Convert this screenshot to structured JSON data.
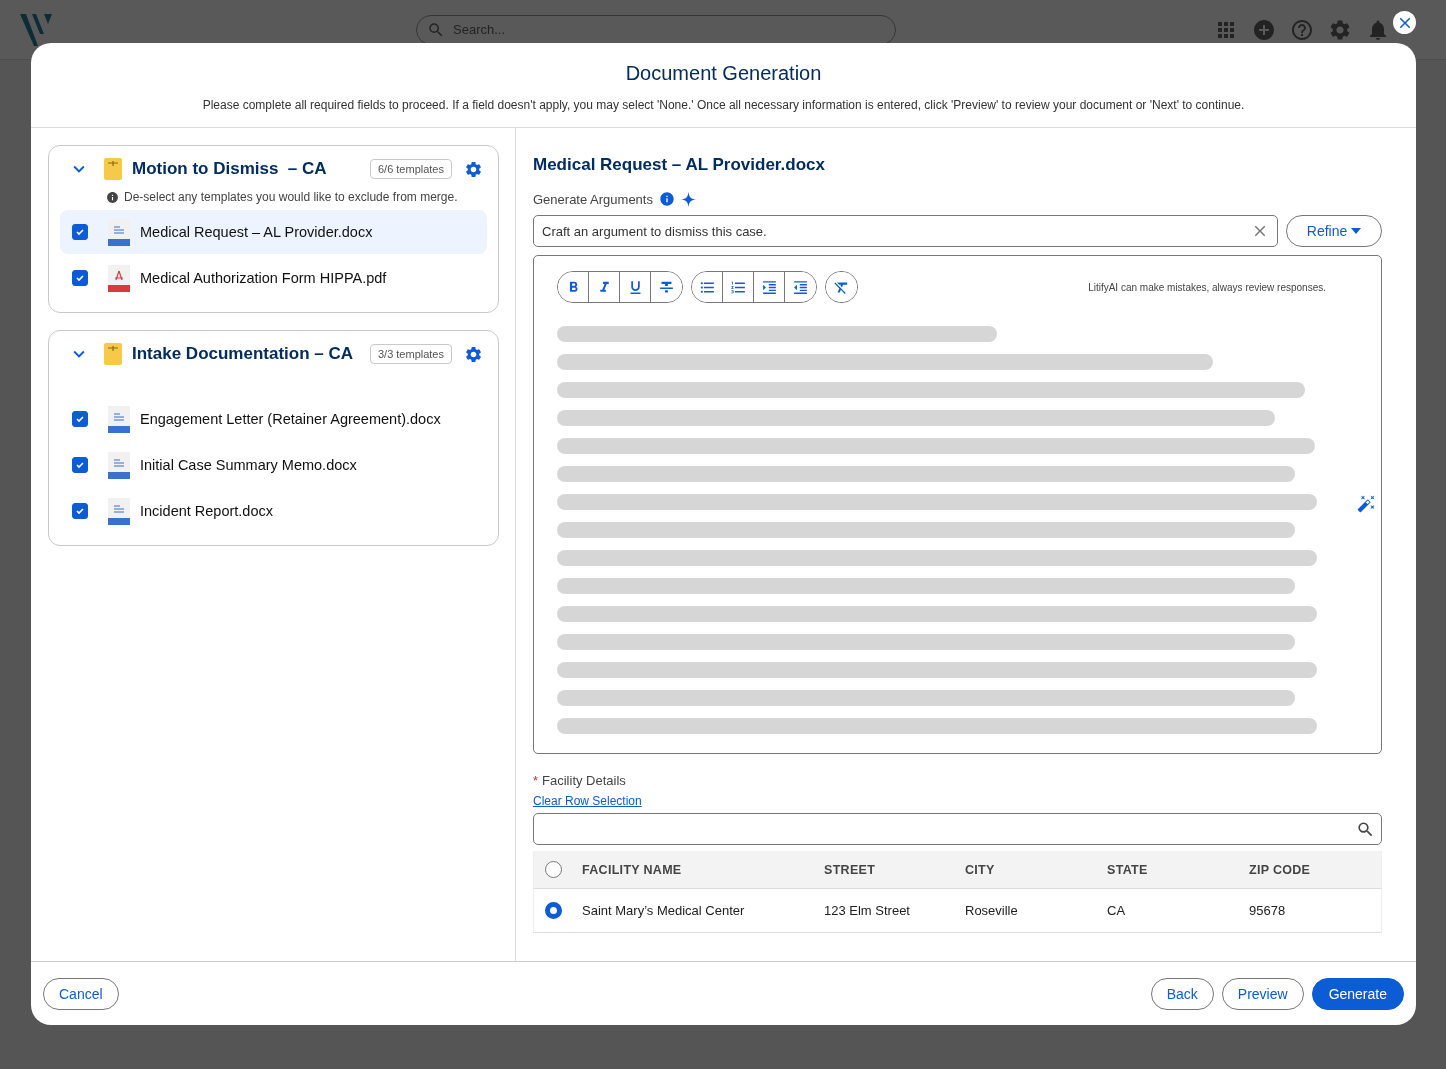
{
  "background_app": {
    "search": {
      "placeholder": "Search..."
    }
  },
  "dialog": {
    "title": "Document Generation",
    "instructions": "Please complete all required fields to proceed. If a field doesn't apply, you may select 'None.' Once all necessary information is entered, click 'Preview' to review your document or 'Next' to continue.",
    "template_groups": [
      {
        "name": "Motion to Dismiss  – CA",
        "count": "6/6 templates",
        "expanded": true,
        "hint": "De-select any templates you would like to exclude from merge.",
        "templates": [
          {
            "name": "Medical Request – AL Provider.docx",
            "kind": "word",
            "checked": true,
            "selected": true
          },
          {
            "name": "Medical Authorization Form HIPPA.pdf",
            "kind": "pdf",
            "checked": true,
            "selected": false
          }
        ]
      },
      {
        "name": "Intake Documentation – CA",
        "count": "3/3 templates",
        "expanded": true,
        "templates": [
          {
            "name": "Engagement Letter (Retainer Agreement).docx",
            "kind": "word",
            "checked": true,
            "selected": false
          },
          {
            "name": "Initial Case Summary Memo.docx",
            "kind": "word",
            "checked": true,
            "selected": false
          },
          {
            "name": "Incident Report.docx",
            "kind": "word",
            "checked": true,
            "selected": false
          }
        ]
      }
    ],
    "editor": {
      "title": "Medical Request – AL Provider.docx",
      "arguments_label": "Generate Arguments",
      "prompt_value": "Craft an argument to dismiss this case.",
      "refine_label": "Refine",
      "toolbar_groups": [
        [
          {
            "kind": "bold"
          },
          {
            "kind": "italic"
          },
          {
            "kind": "underline"
          },
          {
            "kind": "strikethrough"
          }
        ],
        [
          {
            "kind": "bulleted_list"
          },
          {
            "kind": "numbered_list"
          },
          {
            "kind": "indent"
          },
          {
            "kind": "outdent"
          }
        ],
        [
          {
            "kind": "clear_formatting"
          }
        ]
      ],
      "disclaimer": "LitifyAI can make mistakes, always review responses.",
      "loading": true
    },
    "facility": {
      "label": "Facility Details",
      "required_mark": "*",
      "clear_link": "Clear Row Selection",
      "all_selected": false,
      "columns": [
        "FACILITY NAME",
        "STREET",
        "CITY",
        "STATE",
        "ZIP CODE"
      ],
      "rows": [
        {
          "cells": [
            "Saint Mary’s Medical Center",
            "123 Elm Street",
            "Roseville",
            "CA",
            "95678"
          ],
          "selected": true
        }
      ]
    },
    "footer": {
      "cancel": "Cancel",
      "back": "Back",
      "preview": "Preview",
      "generate": "Generate"
    }
  }
}
